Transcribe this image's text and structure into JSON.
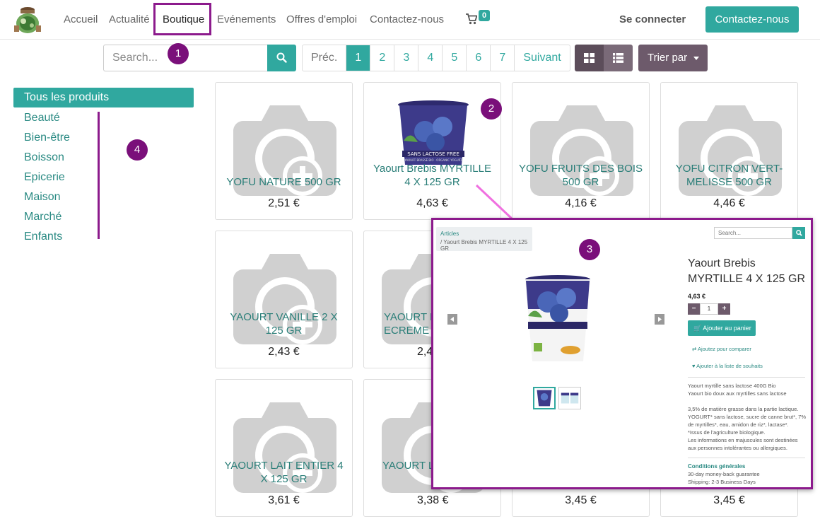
{
  "nav": {
    "items": [
      "Accueil",
      "Actualité",
      "Boutique",
      "Evénements",
      "Offres d'emploi",
      "Contactez-nous"
    ],
    "cart_count": "0",
    "signin": "Se connecter",
    "contact_button": "Contactez-nous"
  },
  "toolbar": {
    "search_placeholder": "Search...",
    "pager": {
      "prev": "Préc.",
      "pages": [
        "1",
        "2",
        "3",
        "4",
        "5",
        "6",
        "7"
      ],
      "next": "Suivant",
      "current": "1"
    },
    "sort_label": "Trier par"
  },
  "sidebar": {
    "all_label": "Tous les produits",
    "categories": [
      "Beauté",
      "Bien-être",
      "Boisson",
      "Epicerie",
      "Maison",
      "Marché",
      "Enfants"
    ]
  },
  "annotations": [
    "1",
    "2",
    "3",
    "4"
  ],
  "products": [
    {
      "name": "YOFU NATURE 500 GR",
      "price": "2,51 €"
    },
    {
      "name": "Yaourt Brebis MYRTILLE 4 X 125 GR",
      "price": "4,63 €"
    },
    {
      "name": "YOFU FRUITS DES BOIS 500 GR",
      "price": "4,16 €"
    },
    {
      "name": "YOFU CITRON VERT-MELISSE 500 GR",
      "price": "4,46 €"
    },
    {
      "name": "YAOURT VANILLE 2 X 125 GR",
      "price": "2,43 €"
    },
    {
      "name": "YAOURT NATURE ECREME 4",
      "price": "2,4"
    },
    {
      "name": "YAOURT LAIT ENTIER 4 X 125 GR",
      "price": "3,61 €"
    },
    {
      "name": "YAOURT LAIT PECHE 2",
      "price": "3,38 €"
    },
    {
      "name": "",
      "price": "3,45 €"
    },
    {
      "name": "",
      "price": "3,45 €"
    }
  ],
  "product_page": {
    "breadcrumb_root": "Articles",
    "breadcrumb_current": "/   Yaourt Brebis MYRTILLE 4 X 125 GR",
    "search_placeholder": "Search...",
    "title": "Yaourt Brebis MYRTILLE 4 X 125 GR",
    "price": "4,63 €",
    "qty_minus": "−",
    "qty": "1",
    "qty_plus": "+",
    "add_to_cart": "Ajouter au panier",
    "compare": "Ajoutez pour comparer",
    "wishlist": "Ajouter à la liste de souhaits",
    "description": [
      "Yaourt myrtille sans lactose 400G Bio",
      "Yaourt bio doux aux myrtilles sans lactose",
      "",
      "3,5% de matière grasse dans la partie lactique.",
      "YOGURT* sans lactose, sucre de canne brut*, 7%",
      "de myrtilles*, eau, amidon de riz*, lactase*.",
      "*Issus de l'agriculture biologique.",
      "Les informations en majuscules sont destinées",
      "aux personnes intolérantes ou allergiques."
    ],
    "conditions_title": "Conditions générales",
    "guarantee": "30-day money-back guarantee",
    "shipping": "Shipping: 2-3 Business Days",
    "cup_label": "SANS LACTOSE FREE",
    "cup_sub": "YAOURT BRASSÉ BIO · ORGANIC YOGURT"
  },
  "colors": {
    "accent": "#30a89f",
    "annotation": "#8c1a8c",
    "sort": "#6d5a6b"
  }
}
